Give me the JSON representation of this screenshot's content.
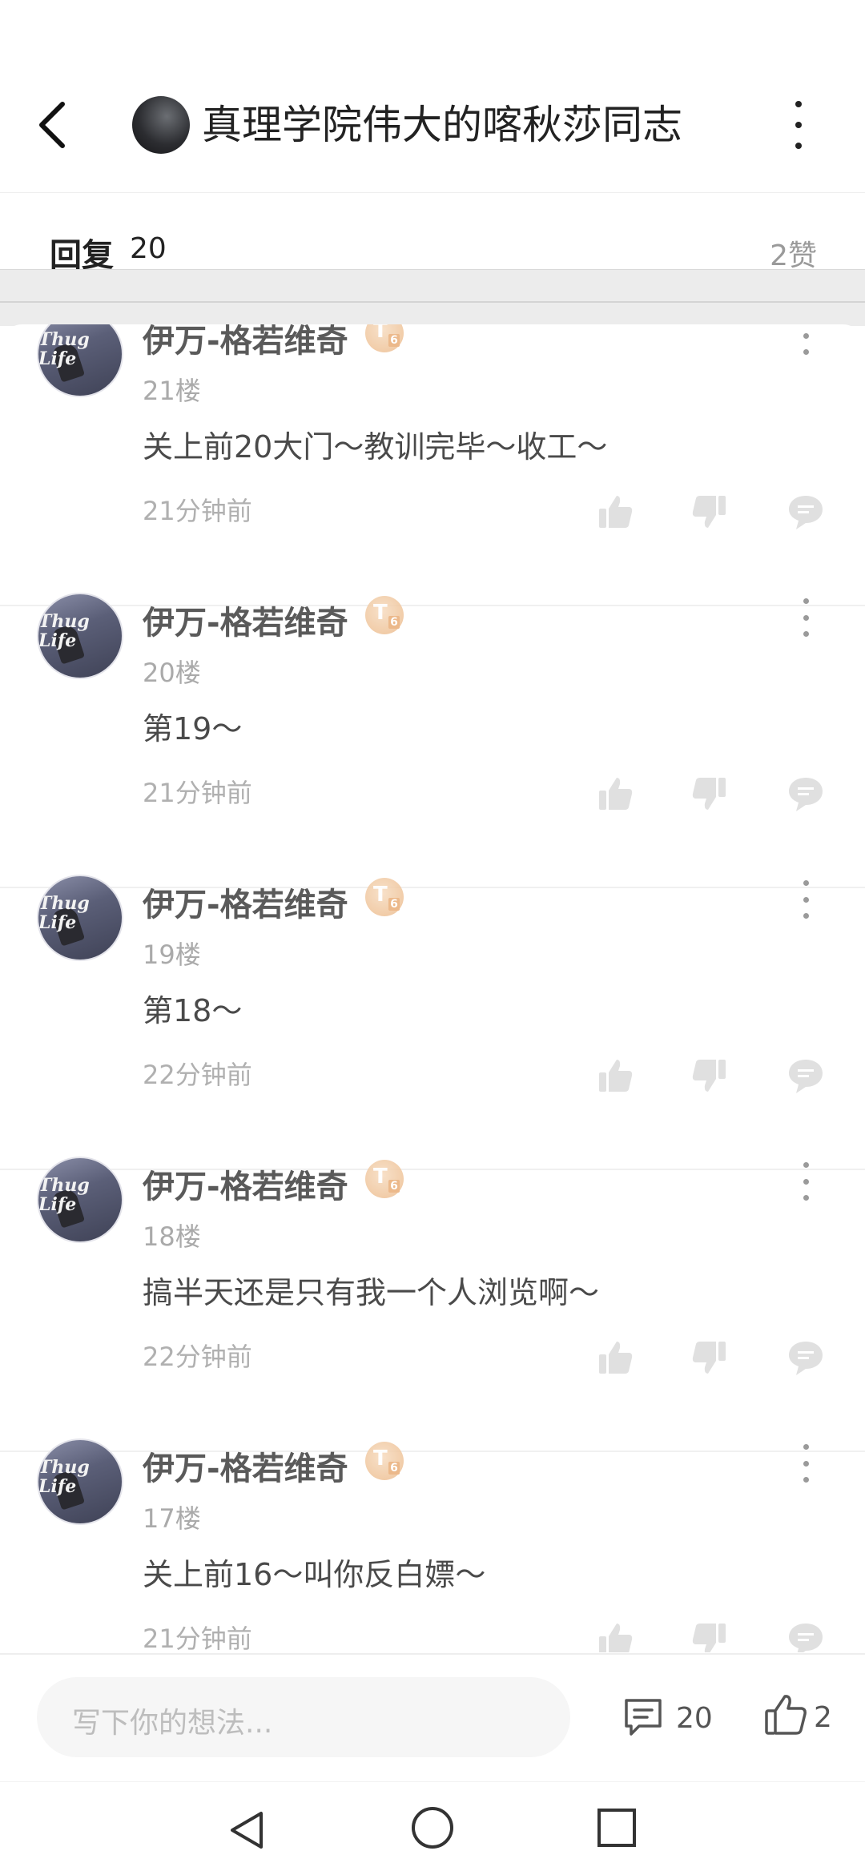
{
  "header": {
    "title": "真理学院伟大的喀秋莎同志"
  },
  "summary": {
    "reply_label": "回复",
    "reply_count": "20",
    "likes_total": "2赞"
  },
  "replies": [
    {
      "username": "伊万-格若维奇",
      "level": "T",
      "level_num": "6",
      "floor": "21楼",
      "content": "关上前20大门～教训完毕～收工～",
      "time": "21分钟前"
    },
    {
      "username": "伊万-格若维奇",
      "level": "T",
      "level_num": "6",
      "floor": "20楼",
      "content": "第19～",
      "time": "21分钟前"
    },
    {
      "username": "伊万-格若维奇",
      "level": "T",
      "level_num": "6",
      "floor": "19楼",
      "content": "第18～",
      "time": "22分钟前"
    },
    {
      "username": "伊万-格若维奇",
      "level": "T",
      "level_num": "6",
      "floor": "18楼",
      "content": "搞半天还是只有我一个人浏览啊～",
      "time": "22分钟前"
    },
    {
      "username": "伊万-格若维奇",
      "level": "T",
      "level_num": "6",
      "floor": "17楼",
      "content": "关上前16～叫你反白嫖～",
      "time": "21分钟前"
    }
  ],
  "avatar_text": "Thug Life",
  "bottom_bar": {
    "input_placeholder": "写下你的想法...",
    "comment_count": "20",
    "like_count": "2"
  },
  "icons": {
    "back": "chevron-left-icon",
    "more": "more-vertical-icon",
    "thumb_up": "thumb-up-icon",
    "thumb_down": "thumb-down-icon",
    "reply": "comment-bubble-icon"
  },
  "colors": {
    "text_primary": "#222222",
    "text_secondary": "#aaaaaa",
    "badge": "#efc49a"
  }
}
